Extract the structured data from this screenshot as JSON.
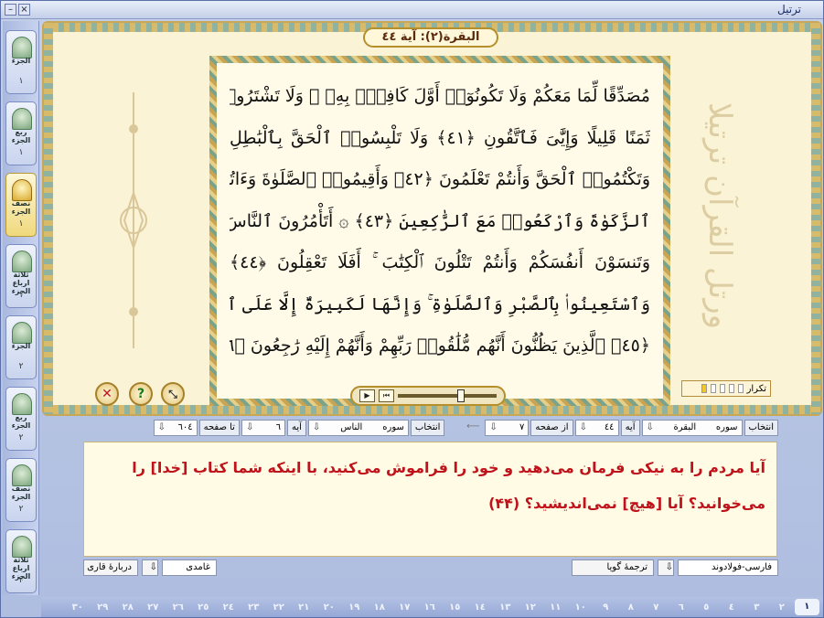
{
  "window": {
    "title": "ترتیل",
    "buttons": [
      "–",
      "×"
    ]
  },
  "sidebar": {
    "items": [
      {
        "label": "الجزء",
        "num": "١",
        "active": false
      },
      {
        "label": "ربع الجزء",
        "num": "١",
        "active": false
      },
      {
        "label": "نصف الجزء",
        "num": "١",
        "active": true
      },
      {
        "label": "ثلاثة ارباع الجزء",
        "num": "١",
        "active": false
      },
      {
        "label": "الجزء",
        "num": "٢",
        "active": false
      },
      {
        "label": "ربع الجزء",
        "num": "٢",
        "active": false
      },
      {
        "label": "نصف الجزء",
        "num": "٢",
        "active": false
      },
      {
        "label": "ثلاثة ارباع الجزء",
        "num": "٢",
        "active": false
      }
    ]
  },
  "header": {
    "sura_title": "البقرة(٢): آية ٤٤"
  },
  "quran": {
    "lines": [
      "مُصَدِّقًا لِّمَا مَعَكُمْ وَلَا تَكُونُوٓا۟ أَوَّلَ كَافِرٍۭ بِهِۦ ۖ وَلَا تَشْتَرُوا۟ بِـَٔايَٰتِى",
      "ثَمَنًا قَلِيلًا وَإِيَّٰىَ فَٱتَّقُونِ ﴿٤١﴾ وَلَا تَلْبِسُوا۟ ٱلْحَقَّ بِٱلْبَٰطِلِ",
      "وَتَكْتُمُوا۟ ٱلْحَقَّ وَأَنتُمْ تَعْلَمُونَ ﴿٤٢﴾ وَأَقِيمُوا۟ ٱلصَّلَوٰةَ وَءَاتُوا۟",
      "ٱلزَّكَوٰةَ وَٱرْكَعُوا۟ مَعَ ٱلرَّٰكِعِينَ ﴿٤٣﴾ ۞ أَتَأْمُرُونَ ٱلنَّاسَ بِٱلْبِرِّ",
      "وَتَنسَوْنَ أَنفُسَكُمْ وَأَنتُمْ تَتْلُونَ ٱلْكِتَٰبَ ۚ أَفَلَا تَعْقِلُونَ ﴿٤٤﴾",
      "وَٱسْتَعِينُوا۟ بِٱلصَّبْرِ وَٱلصَّلَوٰةِ ۚ وَإِنَّهَا لَكَبِيرَةٌ إِلَّا عَلَى ٱلْخَٰشِعِينَ",
      "﴿٤٥﴾ ٱلَّذِينَ يَظُنُّونَ أَنَّهُم مُّلَٰقُوا۟ رَبِّهِمْ وَأَنَّهُمْ إِلَيْهِ رَٰجِعُونَ ﴿٤٦﴾"
    ]
  },
  "calligraphy": "ورتل القرآن ترتیلا",
  "repeat": {
    "label": "تکرار",
    "filled": 1,
    "total": 5
  },
  "nav": {
    "from_label": "انتخاب",
    "sura_label": "سوره",
    "sura_value": "البقرة",
    "aya_label": "آیه",
    "aya_value": "٤٤",
    "page_label": "از صفحه",
    "page_value": "٧",
    "to_label": "انتخاب",
    "to_sura_label": "سوره",
    "to_sura_value": "الناس",
    "to_aya_label": "آیه",
    "to_aya_value": "٦",
    "to_page_label": "تا صفحه",
    "to_page_value": "٦٠٤"
  },
  "translation": {
    "text": "آیا مردم را به نیکی فرمان می‌دهید و خود را فراموش می‌کنید، با اینکه شما کتاب [خدا] را می‌خوانید؟ آیا [هیچ] نمی‌اندیشید؟ (۴۴)"
  },
  "bottom": {
    "translator": "فارسی-فولادوند",
    "voice_translation": "ترجمهٔ گویا",
    "reciter": "غامدی",
    "about_reciter": "دربارهٔ قاری"
  },
  "juz_strip": [
    "١",
    "٢",
    "٣",
    "٤",
    "٥",
    "٦",
    "٧",
    "٨",
    "٩",
    "١٠",
    "١١",
    "١٢",
    "١٣",
    "١٤",
    "١٥",
    "١٦",
    "١٧",
    "١٨",
    "١٩",
    "٢٠",
    "٢١",
    "٢٢",
    "٢٣",
    "٢٤",
    "٢٥",
    "٢٦",
    "٢٧",
    "٢٨",
    "٢٩",
    "٣٠"
  ],
  "player": {
    "play": "▶",
    "stop": "⏮"
  }
}
